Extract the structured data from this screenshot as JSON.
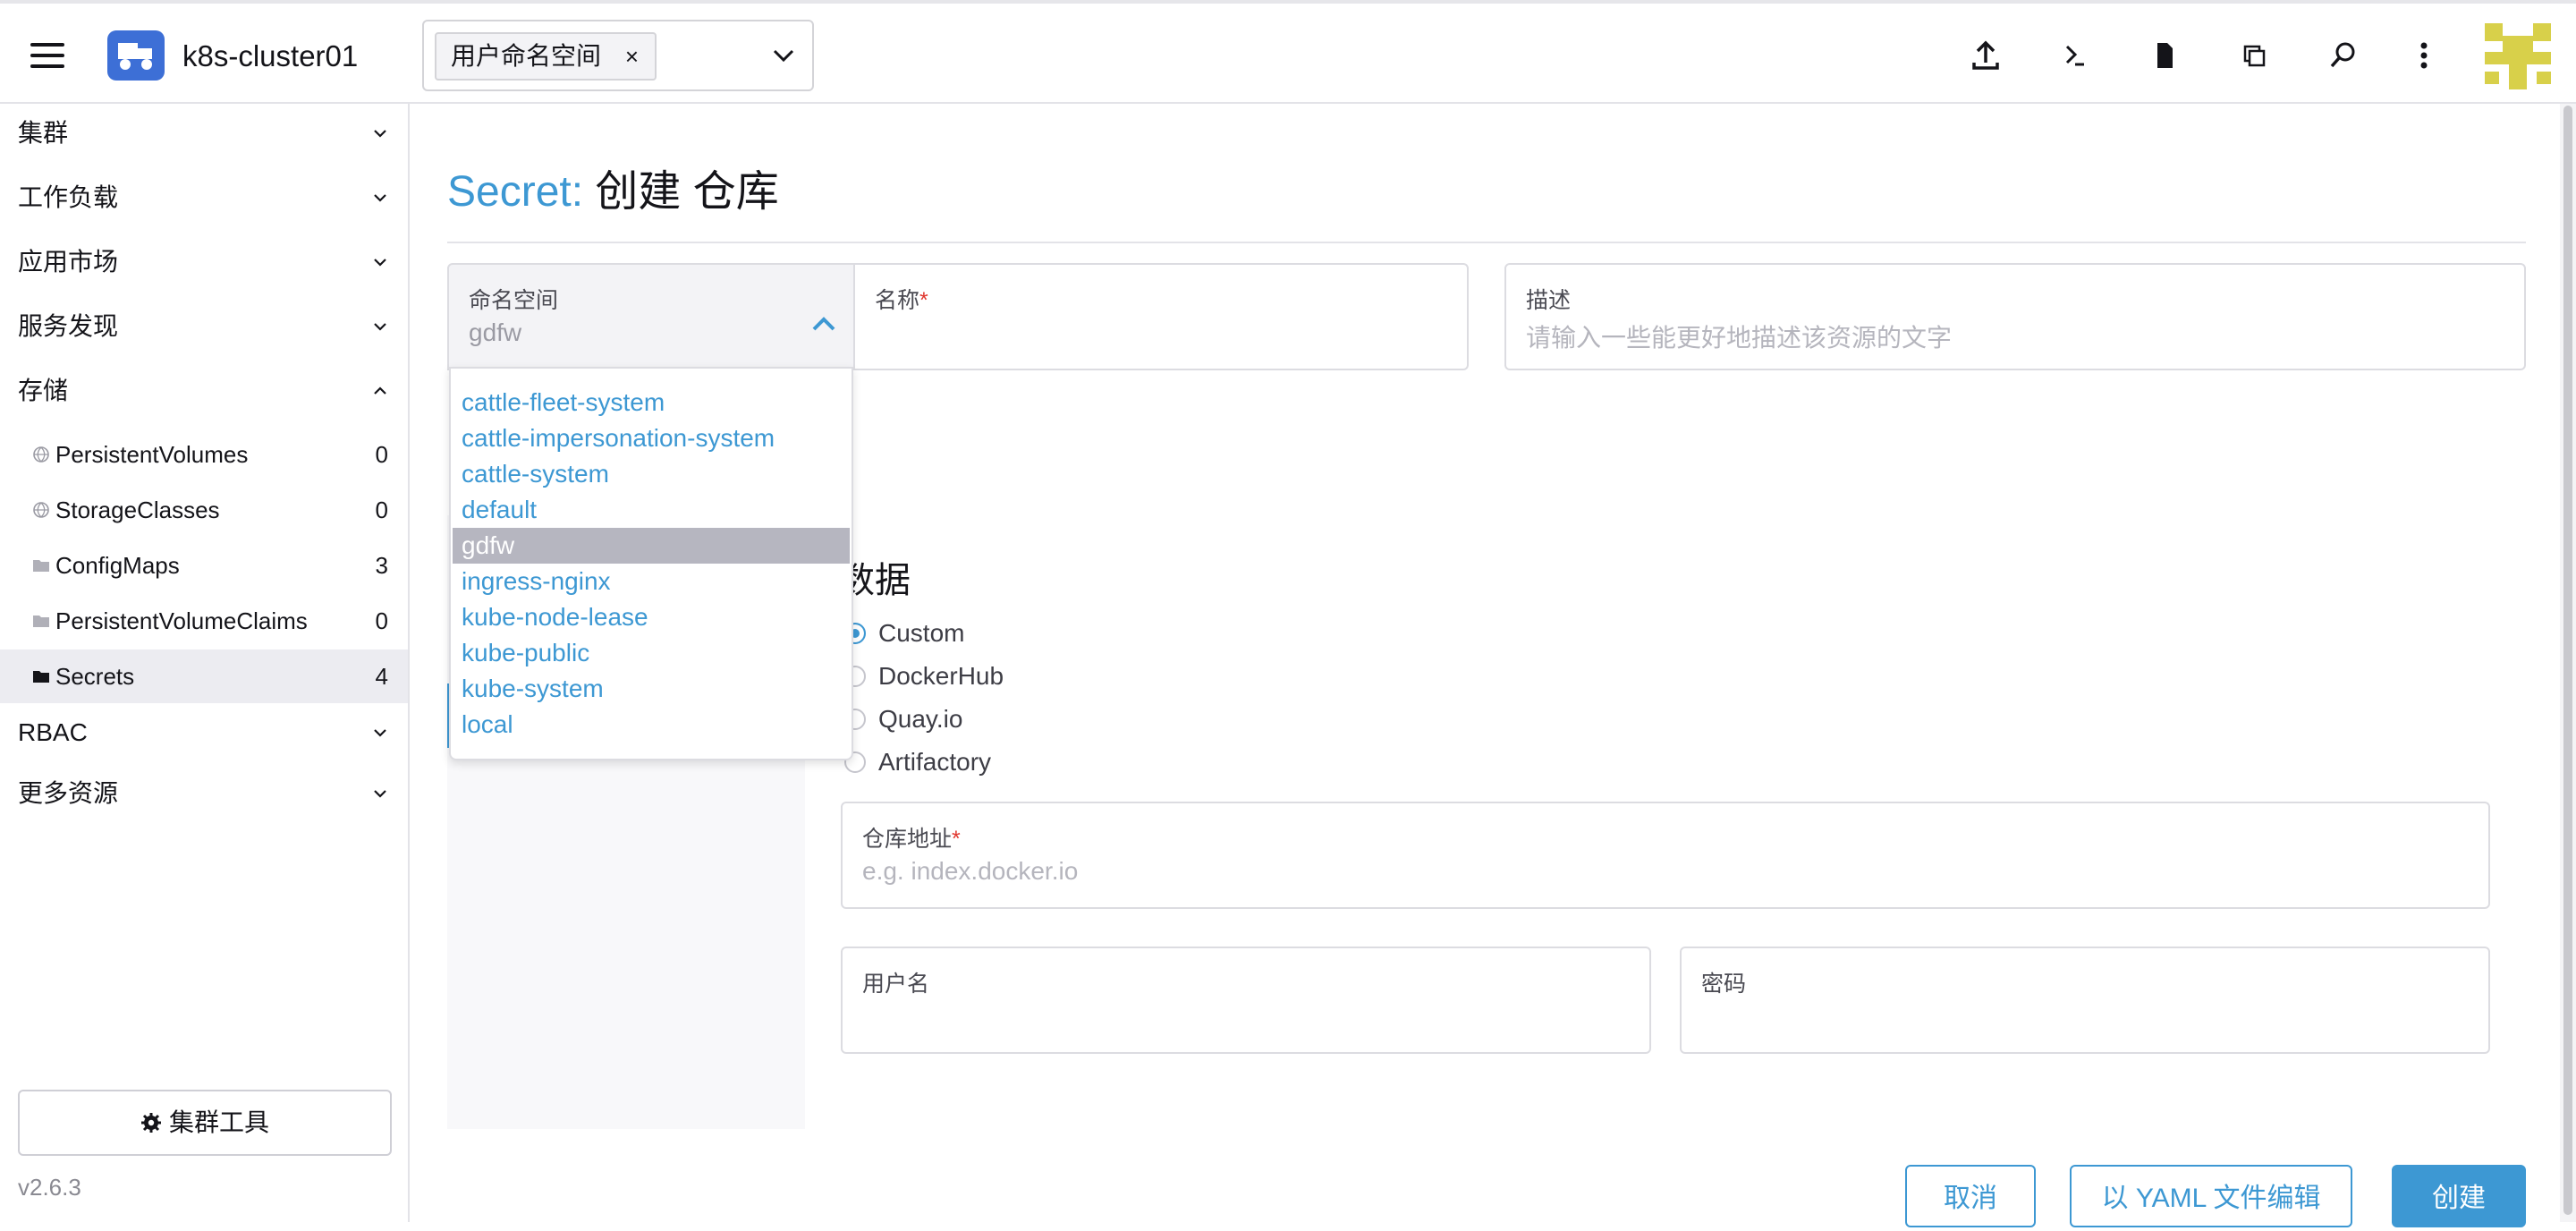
{
  "topbar": {
    "cluster_name": "k8s-cluster01",
    "namespace_chip": "用户命名空间",
    "namespace_chip_remove": "×",
    "icons": [
      "upload-icon",
      "terminal-icon",
      "file-icon",
      "copy-icon",
      "search-icon",
      "more-vertical-icon"
    ]
  },
  "sidebar": {
    "groups": [
      {
        "label": "集群",
        "expanded": false
      },
      {
        "label": "工作负载",
        "expanded": false
      },
      {
        "label": "应用市场",
        "expanded": false
      },
      {
        "label": "服务发现",
        "expanded": false
      },
      {
        "label": "存储",
        "expanded": true
      },
      {
        "label": "RBAC",
        "expanded": false
      },
      {
        "label": "更多资源",
        "expanded": false
      }
    ],
    "storage_items": [
      {
        "label": "PersistentVolumes",
        "count": "0",
        "icon": "globe-icon"
      },
      {
        "label": "StorageClasses",
        "count": "0",
        "icon": "globe-icon"
      },
      {
        "label": "ConfigMaps",
        "count": "3",
        "icon": "folder-icon"
      },
      {
        "label": "PersistentVolumeClaims",
        "count": "0",
        "icon": "folder-icon"
      },
      {
        "label": "Secrets",
        "count": "4",
        "icon": "folder-icon",
        "active": true
      }
    ],
    "cluster_tools": "集群工具",
    "version": "v2.6.3"
  },
  "main": {
    "title_resource": "Secret:",
    "title_action": "创建 仓库",
    "namespace_field": {
      "label": "命名空间",
      "value": "gdfw"
    },
    "name_field": {
      "label": "名称",
      "required_mark": "*"
    },
    "description_field": {
      "label": "描述",
      "placeholder": "请输入一些能更好地描述该资源的文字"
    },
    "data_section": {
      "title": "数据",
      "radios": [
        {
          "label": "Custom",
          "checked": true
        },
        {
          "label": "DockerHub",
          "checked": false
        },
        {
          "label": "Quay.io",
          "checked": false
        },
        {
          "label": "Artifactory",
          "checked": false
        }
      ],
      "registry_field": {
        "label": "仓库地址",
        "required_mark": "*",
        "placeholder": "e.g. index.docker.io"
      },
      "username_field": {
        "label": "用户名"
      },
      "password_field": {
        "label": "密码"
      }
    },
    "namespace_dropdown": [
      "cattle-fleet-system",
      "cattle-impersonation-system",
      "cattle-system",
      "default",
      "gdfw",
      "ingress-nginx",
      "kube-node-lease",
      "kube-public",
      "kube-system",
      "local"
    ],
    "highlighted_option": "gdfw",
    "buttons": {
      "cancel": "取消",
      "yaml": "以 YAML 文件编辑",
      "create": "创建"
    }
  },
  "colors": {
    "accent": "#3d98d3",
    "logo": "#3d6fd6",
    "required": "#e0362e",
    "highlight": "#b6b6c0"
  }
}
